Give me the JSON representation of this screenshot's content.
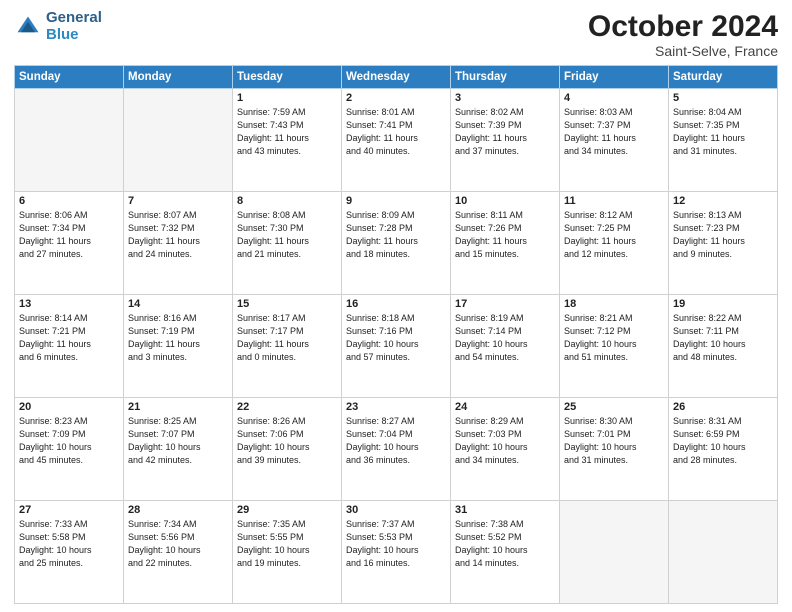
{
  "header": {
    "logo_general": "General",
    "logo_blue": "Blue",
    "month_title": "October 2024",
    "location": "Saint-Selve, France"
  },
  "days_of_week": [
    "Sunday",
    "Monday",
    "Tuesday",
    "Wednesday",
    "Thursday",
    "Friday",
    "Saturday"
  ],
  "weeks": [
    [
      {
        "num": "",
        "detail": ""
      },
      {
        "num": "",
        "detail": ""
      },
      {
        "num": "1",
        "detail": "Sunrise: 7:59 AM\nSunset: 7:43 PM\nDaylight: 11 hours\nand 43 minutes."
      },
      {
        "num": "2",
        "detail": "Sunrise: 8:01 AM\nSunset: 7:41 PM\nDaylight: 11 hours\nand 40 minutes."
      },
      {
        "num": "3",
        "detail": "Sunrise: 8:02 AM\nSunset: 7:39 PM\nDaylight: 11 hours\nand 37 minutes."
      },
      {
        "num": "4",
        "detail": "Sunrise: 8:03 AM\nSunset: 7:37 PM\nDaylight: 11 hours\nand 34 minutes."
      },
      {
        "num": "5",
        "detail": "Sunrise: 8:04 AM\nSunset: 7:35 PM\nDaylight: 11 hours\nand 31 minutes."
      }
    ],
    [
      {
        "num": "6",
        "detail": "Sunrise: 8:06 AM\nSunset: 7:34 PM\nDaylight: 11 hours\nand 27 minutes."
      },
      {
        "num": "7",
        "detail": "Sunrise: 8:07 AM\nSunset: 7:32 PM\nDaylight: 11 hours\nand 24 minutes."
      },
      {
        "num": "8",
        "detail": "Sunrise: 8:08 AM\nSunset: 7:30 PM\nDaylight: 11 hours\nand 21 minutes."
      },
      {
        "num": "9",
        "detail": "Sunrise: 8:09 AM\nSunset: 7:28 PM\nDaylight: 11 hours\nand 18 minutes."
      },
      {
        "num": "10",
        "detail": "Sunrise: 8:11 AM\nSunset: 7:26 PM\nDaylight: 11 hours\nand 15 minutes."
      },
      {
        "num": "11",
        "detail": "Sunrise: 8:12 AM\nSunset: 7:25 PM\nDaylight: 11 hours\nand 12 minutes."
      },
      {
        "num": "12",
        "detail": "Sunrise: 8:13 AM\nSunset: 7:23 PM\nDaylight: 11 hours\nand 9 minutes."
      }
    ],
    [
      {
        "num": "13",
        "detail": "Sunrise: 8:14 AM\nSunset: 7:21 PM\nDaylight: 11 hours\nand 6 minutes."
      },
      {
        "num": "14",
        "detail": "Sunrise: 8:16 AM\nSunset: 7:19 PM\nDaylight: 11 hours\nand 3 minutes."
      },
      {
        "num": "15",
        "detail": "Sunrise: 8:17 AM\nSunset: 7:17 PM\nDaylight: 11 hours\nand 0 minutes."
      },
      {
        "num": "16",
        "detail": "Sunrise: 8:18 AM\nSunset: 7:16 PM\nDaylight: 10 hours\nand 57 minutes."
      },
      {
        "num": "17",
        "detail": "Sunrise: 8:19 AM\nSunset: 7:14 PM\nDaylight: 10 hours\nand 54 minutes."
      },
      {
        "num": "18",
        "detail": "Sunrise: 8:21 AM\nSunset: 7:12 PM\nDaylight: 10 hours\nand 51 minutes."
      },
      {
        "num": "19",
        "detail": "Sunrise: 8:22 AM\nSunset: 7:11 PM\nDaylight: 10 hours\nand 48 minutes."
      }
    ],
    [
      {
        "num": "20",
        "detail": "Sunrise: 8:23 AM\nSunset: 7:09 PM\nDaylight: 10 hours\nand 45 minutes."
      },
      {
        "num": "21",
        "detail": "Sunrise: 8:25 AM\nSunset: 7:07 PM\nDaylight: 10 hours\nand 42 minutes."
      },
      {
        "num": "22",
        "detail": "Sunrise: 8:26 AM\nSunset: 7:06 PM\nDaylight: 10 hours\nand 39 minutes."
      },
      {
        "num": "23",
        "detail": "Sunrise: 8:27 AM\nSunset: 7:04 PM\nDaylight: 10 hours\nand 36 minutes."
      },
      {
        "num": "24",
        "detail": "Sunrise: 8:29 AM\nSunset: 7:03 PM\nDaylight: 10 hours\nand 34 minutes."
      },
      {
        "num": "25",
        "detail": "Sunrise: 8:30 AM\nSunset: 7:01 PM\nDaylight: 10 hours\nand 31 minutes."
      },
      {
        "num": "26",
        "detail": "Sunrise: 8:31 AM\nSunset: 6:59 PM\nDaylight: 10 hours\nand 28 minutes."
      }
    ],
    [
      {
        "num": "27",
        "detail": "Sunrise: 7:33 AM\nSunset: 5:58 PM\nDaylight: 10 hours\nand 25 minutes."
      },
      {
        "num": "28",
        "detail": "Sunrise: 7:34 AM\nSunset: 5:56 PM\nDaylight: 10 hours\nand 22 minutes."
      },
      {
        "num": "29",
        "detail": "Sunrise: 7:35 AM\nSunset: 5:55 PM\nDaylight: 10 hours\nand 19 minutes."
      },
      {
        "num": "30",
        "detail": "Sunrise: 7:37 AM\nSunset: 5:53 PM\nDaylight: 10 hours\nand 16 minutes."
      },
      {
        "num": "31",
        "detail": "Sunrise: 7:38 AM\nSunset: 5:52 PM\nDaylight: 10 hours\nand 14 minutes."
      },
      {
        "num": "",
        "detail": ""
      },
      {
        "num": "",
        "detail": ""
      }
    ]
  ]
}
